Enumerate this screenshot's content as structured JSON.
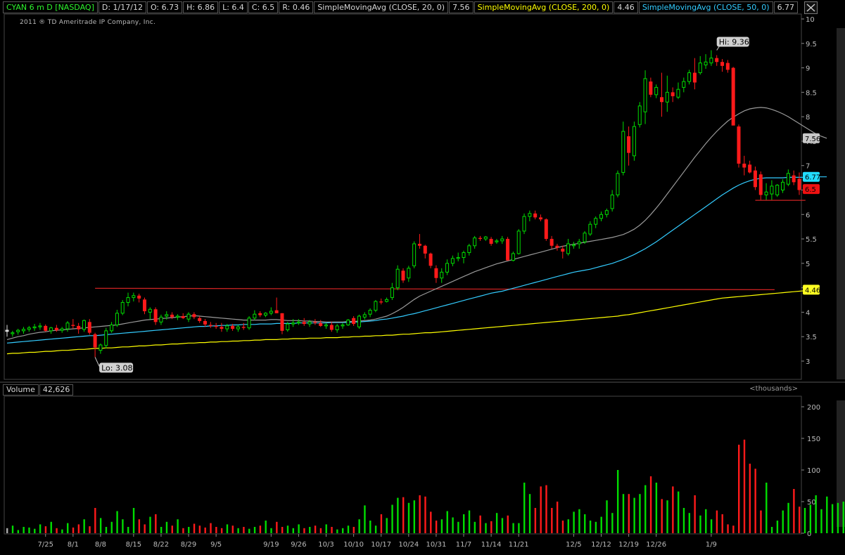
{
  "header": {
    "symbol": "CYAN 6 m D [NASDAQ]",
    "date": "D: 1/17/12",
    "open": "O: 6.73",
    "high": "H: 6.86",
    "low": "L: 6.4",
    "close": "C: 6.5",
    "range": "R: 0.46",
    "sma20_label": "SimpleMovingAvg (CLOSE, 20, 0)",
    "sma20_value": "7.56",
    "sma200_label": "SimpleMovingAvg (CLOSE, 200, 0)",
    "sma200_value": "4.46",
    "sma50_label": "SimpleMovingAvg (CLOSE, 50, 0)",
    "sma50_value": "6.77"
  },
  "copyright": "2011 ® TD Ameritrade IP Company, Inc.",
  "volume_header": {
    "label": "Volume",
    "value": "42,626",
    "units": "<thousands>"
  },
  "icons": {
    "close": "close-icon"
  },
  "colors": {
    "up": "#00dd00",
    "down": "#ff1a1a",
    "sma20": "#9a9a9a",
    "sma50": "#33ccff",
    "sma200": "#ffff00",
    "support": "#cc2222"
  },
  "chart_data": {
    "type": "candlestick",
    "price_axis": {
      "min": 2.5,
      "max": 10,
      "ticks": [
        3,
        3.5,
        4,
        4.5,
        5,
        5.5,
        6,
        6.5,
        7,
        7.5,
        8,
        8.5,
        9,
        9.5,
        10
      ],
      "tick_labels": [
        "3",
        "3.5",
        "4",
        "4.5",
        "5",
        "5.5",
        "6",
        "6.5",
        "7",
        "7.5",
        "8",
        "8.5",
        "9",
        "9.5",
        "10"
      ]
    },
    "volume_axis": {
      "min": 0,
      "max": 220,
      "ticks": [
        0,
        50,
        100,
        150,
        200
      ],
      "tick_labels": [
        "0",
        "50",
        "100",
        "150",
        "200"
      ]
    },
    "x_labels": [
      "7/25",
      "8/1",
      "8/8",
      "8/15",
      "8/22",
      "8/29",
      "9/5",
      "9/19",
      "9/26",
      "10/3",
      "10/10",
      "10/17",
      "10/24",
      "10/31",
      "11/7",
      "11/14",
      "11/21",
      "12/5",
      "12/12",
      "12/19",
      "12/26",
      "1/9"
    ],
    "annotations": {
      "high": "Hi: 9.36",
      "low": "Lo: 3.08"
    },
    "value_badges": {
      "sma20": "7.56",
      "sma50": "6.77",
      "last": "6.5",
      "sma200": "4.46"
    },
    "candles": [
      [
        3.64,
        3.74,
        3.5,
        3.6
      ],
      [
        3.56,
        3.62,
        3.5,
        3.58
      ],
      [
        3.6,
        3.66,
        3.54,
        3.63
      ],
      [
        3.62,
        3.7,
        3.56,
        3.65
      ],
      [
        3.65,
        3.72,
        3.6,
        3.68
      ],
      [
        3.68,
        3.76,
        3.62,
        3.7
      ],
      [
        3.7,
        3.78,
        3.64,
        3.72
      ],
      [
        3.72,
        3.75,
        3.6,
        3.62
      ],
      [
        3.62,
        3.7,
        3.56,
        3.68
      ],
      [
        3.68,
        3.74,
        3.6,
        3.63
      ],
      [
        3.63,
        3.7,
        3.58,
        3.66
      ],
      [
        3.66,
        3.82,
        3.6,
        3.78
      ],
      [
        3.74,
        3.86,
        3.66,
        3.72
      ],
      [
        3.72,
        3.78,
        3.56,
        3.65
      ],
      [
        3.65,
        3.85,
        3.6,
        3.83
      ],
      [
        3.8,
        3.86,
        3.54,
        3.58
      ],
      [
        3.55,
        3.58,
        3.08,
        3.28
      ],
      [
        3.22,
        3.36,
        3.15,
        3.33
      ],
      [
        3.32,
        3.68,
        3.26,
        3.62
      ],
      [
        3.62,
        3.8,
        3.58,
        3.74
      ],
      [
        3.74,
        4.05,
        3.7,
        3.98
      ],
      [
        3.98,
        4.25,
        3.94,
        4.2
      ],
      [
        4.2,
        4.4,
        4.12,
        4.3
      ],
      [
        4.3,
        4.4,
        4.22,
        4.34
      ],
      [
        4.34,
        4.38,
        4.2,
        4.28
      ],
      [
        4.26,
        4.3,
        3.96,
        4.02
      ],
      [
        4.0,
        4.1,
        3.85,
        4.06
      ],
      [
        4.06,
        4.1,
        3.74,
        3.8
      ],
      [
        3.8,
        3.95,
        3.74,
        3.9
      ],
      [
        3.92,
        4.02,
        3.85,
        3.95
      ],
      [
        3.95,
        4.0,
        3.86,
        3.9
      ],
      [
        3.9,
        3.96,
        3.84,
        3.92
      ],
      [
        3.92,
        3.98,
        3.86,
        3.88
      ],
      [
        3.86,
        4.0,
        3.8,
        3.96
      ],
      [
        3.96,
        4.0,
        3.86,
        3.9
      ],
      [
        3.88,
        3.92,
        3.78,
        3.82
      ],
      [
        3.82,
        3.86,
        3.7,
        3.75
      ],
      [
        3.74,
        3.8,
        3.68,
        3.72
      ],
      [
        3.72,
        3.78,
        3.66,
        3.7
      ],
      [
        3.7,
        3.78,
        3.6,
        3.66
      ],
      [
        3.66,
        3.76,
        3.6,
        3.72
      ],
      [
        3.72,
        3.76,
        3.62,
        3.66
      ],
      [
        3.66,
        3.74,
        3.6,
        3.7
      ],
      [
        3.7,
        3.78,
        3.64,
        3.68
      ],
      [
        3.68,
        3.92,
        3.64,
        3.88
      ],
      [
        3.88,
        4.04,
        3.84,
        3.96
      ],
      [
        3.98,
        4.02,
        3.9,
        3.94
      ],
      [
        3.94,
        4.0,
        3.9,
        3.98
      ],
      [
        3.98,
        4.1,
        3.94,
        4.02
      ],
      [
        4.04,
        4.3,
        3.98,
        3.98
      ],
      [
        3.98,
        3.98,
        3.55,
        3.62
      ],
      [
        3.64,
        3.8,
        3.6,
        3.76
      ],
      [
        3.76,
        3.86,
        3.7,
        3.78
      ],
      [
        3.78,
        3.86,
        3.74,
        3.8
      ],
      [
        3.8,
        3.88,
        3.72,
        3.76
      ],
      [
        3.76,
        3.84,
        3.7,
        3.8
      ],
      [
        3.8,
        3.86,
        3.74,
        3.78
      ],
      [
        3.78,
        3.84,
        3.7,
        3.72
      ],
      [
        3.72,
        3.78,
        3.66,
        3.74
      ],
      [
        3.74,
        3.8,
        3.6,
        3.64
      ],
      [
        3.64,
        3.76,
        3.58,
        3.72
      ],
      [
        3.72,
        3.78,
        3.66,
        3.74
      ],
      [
        3.74,
        3.86,
        3.72,
        3.84
      ],
      [
        3.88,
        3.92,
        3.72,
        3.76
      ],
      [
        3.7,
        3.95,
        3.66,
        3.92
      ],
      [
        3.9,
        4.0,
        3.85,
        3.95
      ],
      [
        3.96,
        4.08,
        3.9,
        4.04
      ],
      [
        4.04,
        4.25,
        4.0,
        4.22
      ],
      [
        4.22,
        4.28,
        4.16,
        4.2
      ],
      [
        4.22,
        4.3,
        4.2,
        4.26
      ],
      [
        4.3,
        4.6,
        4.25,
        4.5
      ],
      [
        4.5,
        4.96,
        4.45,
        4.88
      ],
      [
        4.85,
        4.9,
        4.6,
        4.65
      ],
      [
        4.7,
        4.95,
        4.62,
        4.9
      ],
      [
        4.95,
        5.45,
        4.9,
        5.4
      ],
      [
        5.4,
        5.6,
        5.3,
        5.36
      ],
      [
        5.36,
        5.38,
        5.1,
        5.2
      ],
      [
        5.2,
        5.22,
        4.9,
        4.95
      ],
      [
        4.9,
        4.96,
        4.6,
        4.7
      ],
      [
        4.7,
        4.9,
        4.6,
        4.82
      ],
      [
        4.82,
        5.08,
        4.76,
        5.0
      ],
      [
        5.0,
        5.16,
        4.94,
        5.1
      ],
      [
        5.1,
        5.22,
        5.04,
        5.12
      ],
      [
        5.12,
        5.26,
        5.0,
        5.22
      ],
      [
        5.22,
        5.4,
        5.16,
        5.36
      ],
      [
        5.36,
        5.56,
        5.3,
        5.52
      ],
      [
        5.52,
        5.56,
        5.46,
        5.5
      ],
      [
        5.5,
        5.56,
        5.46,
        5.54
      ],
      [
        5.5,
        5.54,
        5.36,
        5.4
      ],
      [
        5.44,
        5.5,
        5.4,
        5.46
      ],
      [
        5.46,
        5.56,
        5.4,
        5.5
      ],
      [
        5.5,
        5.54,
        5.06,
        5.06
      ],
      [
        5.06,
        5.24,
        5.04,
        5.2
      ],
      [
        5.2,
        5.7,
        5.18,
        5.66
      ],
      [
        5.66,
        6.02,
        5.6,
        5.96
      ],
      [
        5.96,
        6.08,
        5.86,
        6.02
      ],
      [
        6.02,
        6.08,
        5.9,
        5.94
      ],
      [
        5.94,
        6.0,
        5.86,
        5.9
      ],
      [
        5.9,
        5.92,
        5.46,
        5.5
      ],
      [
        5.5,
        5.56,
        5.3,
        5.36
      ],
      [
        5.36,
        5.4,
        5.26,
        5.32
      ],
      [
        5.3,
        5.36,
        5.1,
        5.24
      ],
      [
        5.2,
        5.5,
        5.16,
        5.4
      ],
      [
        5.36,
        5.44,
        5.3,
        5.38
      ],
      [
        5.4,
        5.5,
        5.3,
        5.44
      ],
      [
        5.44,
        5.66,
        5.4,
        5.62
      ],
      [
        5.6,
        5.86,
        5.56,
        5.8
      ],
      [
        5.8,
        5.96,
        5.72,
        5.92
      ],
      [
        5.92,
        6.06,
        5.86,
        6.0
      ],
      [
        6.0,
        6.12,
        5.94,
        6.08
      ],
      [
        6.12,
        6.5,
        6.06,
        6.4
      ],
      [
        6.4,
        6.9,
        6.35,
        6.84
      ],
      [
        6.86,
        7.9,
        6.8,
        7.7
      ],
      [
        7.6,
        7.8,
        7.0,
        7.26
      ],
      [
        7.2,
        7.9,
        7.1,
        7.8
      ],
      [
        7.84,
        8.3,
        7.78,
        8.22
      ],
      [
        8.1,
        8.95,
        7.85,
        8.78
      ],
      [
        8.72,
        8.8,
        8.4,
        8.45
      ],
      [
        8.45,
        8.66,
        8.38,
        8.6
      ],
      [
        8.4,
        8.9,
        8.0,
        8.3
      ],
      [
        8.3,
        8.84,
        8.1,
        8.5
      ],
      [
        8.5,
        8.6,
        8.3,
        8.42
      ],
      [
        8.4,
        8.7,
        8.36,
        8.56
      ],
      [
        8.6,
        8.8,
        8.5,
        8.72
      ],
      [
        8.72,
        8.96,
        8.66,
        8.9
      ],
      [
        8.9,
        9.2,
        8.56,
        8.7
      ],
      [
        8.9,
        9.24,
        8.86,
        9.1
      ],
      [
        9.06,
        9.28,
        8.98,
        9.12
      ],
      [
        9.1,
        9.36,
        9.04,
        9.2
      ],
      [
        9.2,
        9.26,
        9.04,
        9.12
      ],
      [
        9.12,
        9.18,
        8.92,
        9.04
      ],
      [
        9.1,
        9.16,
        8.9,
        8.96
      ],
      [
        9.0,
        9.02,
        7.84,
        7.82
      ],
      [
        7.8,
        7.84,
        6.96,
        7.04
      ],
      [
        7.04,
        7.2,
        6.8,
        6.96
      ],
      [
        7.02,
        7.1,
        6.84,
        6.86
      ],
      [
        6.9,
        6.98,
        6.5,
        6.56
      ],
      [
        6.82,
        6.88,
        6.3,
        6.4
      ],
      [
        6.4,
        6.64,
        6.3,
        6.46
      ],
      [
        6.42,
        6.7,
        6.3,
        6.58
      ],
      [
        6.4,
        6.62,
        6.36,
        6.6
      ],
      [
        6.5,
        6.72,
        6.44,
        6.66
      ],
      [
        6.62,
        6.92,
        6.58,
        6.84
      ],
      [
        6.8,
        6.9,
        6.6,
        6.66
      ],
      [
        6.73,
        6.86,
        6.4,
        6.5
      ]
    ],
    "volume": [
      8,
      12,
      5,
      10,
      9,
      7,
      14,
      11,
      18,
      8,
      6,
      16,
      9,
      14,
      22,
      11,
      40,
      24,
      10,
      18,
      35,
      22,
      10,
      40,
      22,
      14,
      26,
      30,
      10,
      18,
      12,
      22,
      8,
      10,
      15,
      12,
      9,
      16,
      10,
      8,
      14,
      12,
      8,
      10,
      7,
      10,
      12,
      20,
      8,
      18,
      10,
      12,
      8,
      14,
      8,
      10,
      12,
      8,
      14,
      10,
      6,
      8,
      12,
      10,
      22,
      44,
      20,
      12,
      30,
      24,
      45,
      56,
      57,
      48,
      52,
      60,
      58,
      34,
      20,
      22,
      35,
      25,
      18,
      30,
      36,
      18,
      28,
      16,
      19,
      32,
      24,
      28,
      16,
      16,
      80,
      62,
      40,
      74,
      76,
      40,
      50,
      20,
      22,
      34,
      38,
      30,
      20,
      18,
      26,
      52,
      32,
      100,
      62,
      62,
      56,
      62,
      76,
      90,
      80,
      54,
      52,
      74,
      66,
      40,
      32,
      60,
      28,
      38,
      22,
      36,
      30,
      14,
      12,
      140,
      148,
      110,
      102,
      36,
      80,
      10,
      20,
      36,
      48,
      70,
      42,
      40,
      45,
      60,
      38,
      58,
      46,
      48,
      50,
      24,
      50,
      60,
      36,
      42,
      56,
      62,
      82,
      48,
      64,
      70,
      40,
      56,
      34,
      138,
      146,
      150,
      104,
      56,
      74,
      12,
      24,
      34,
      48,
      58,
      34,
      50,
      40,
      48,
      28,
      36,
      50,
      60,
      44,
      56,
      80,
      46
    ],
    "sma20": [
      3.44,
      3.47,
      3.5,
      3.52,
      3.55,
      3.57,
      3.59,
      3.6,
      3.62,
      3.63,
      3.64,
      3.65,
      3.66,
      3.67,
      3.68,
      3.69,
      3.7,
      3.71,
      3.72,
      3.73,
      3.74,
      3.76,
      3.78,
      3.8,
      3.82,
      3.84,
      3.85,
      3.86,
      3.87,
      3.88,
      3.89,
      3.9,
      3.91,
      3.92,
      3.93,
      3.92,
      3.91,
      3.9,
      3.89,
      3.88,
      3.87,
      3.86,
      3.85,
      3.84,
      3.84,
      3.84,
      3.84,
      3.84,
      3.85,
      3.85,
      3.84,
      3.83,
      3.83,
      3.83,
      3.82,
      3.82,
      3.81,
      3.81,
      3.8,
      3.8,
      3.8,
      3.8,
      3.81,
      3.81,
      3.82,
      3.83,
      3.84,
      3.86,
      3.89,
      3.92,
      3.97,
      4.03,
      4.1,
      4.18,
      4.26,
      4.33,
      4.38,
      4.43,
      4.48,
      4.53,
      4.58,
      4.63,
      4.68,
      4.73,
      4.78,
      4.83,
      4.87,
      4.91,
      4.95,
      4.99,
      5.02,
      5.05,
      5.08,
      5.11,
      5.14,
      5.17,
      5.2,
      5.23,
      5.26,
      5.29,
      5.32,
      5.35,
      5.37,
      5.39,
      5.41,
      5.43,
      5.45,
      5.47,
      5.49,
      5.51,
      5.53,
      5.56,
      5.59,
      5.64,
      5.7,
      5.78,
      5.88,
      6.0,
      6.13,
      6.27,
      6.42,
      6.57,
      6.72,
      6.87,
      7.02,
      7.17,
      7.31,
      7.45,
      7.58,
      7.7,
      7.81,
      7.91,
      7.99,
      8.06,
      8.12,
      8.16,
      8.18,
      8.19,
      8.18,
      8.15,
      8.11,
      8.06,
      8.0,
      7.93,
      7.86,
      7.79,
      7.72,
      7.65,
      7.6,
      7.56
    ],
    "sma50": [
      3.37,
      3.38,
      3.39,
      3.4,
      3.41,
      3.42,
      3.43,
      3.44,
      3.45,
      3.46,
      3.47,
      3.48,
      3.49,
      3.5,
      3.51,
      3.52,
      3.52,
      3.53,
      3.54,
      3.55,
      3.56,
      3.57,
      3.58,
      3.59,
      3.6,
      3.61,
      3.62,
      3.63,
      3.64,
      3.65,
      3.66,
      3.67,
      3.68,
      3.69,
      3.7,
      3.71,
      3.71,
      3.72,
      3.72,
      3.73,
      3.73,
      3.74,
      3.74,
      3.75,
      3.75,
      3.75,
      3.76,
      3.76,
      3.76,
      3.77,
      3.77,
      3.77,
      3.77,
      3.78,
      3.78,
      3.78,
      3.78,
      3.78,
      3.78,
      3.79,
      3.79,
      3.79,
      3.79,
      3.8,
      3.8,
      3.81,
      3.82,
      3.83,
      3.85,
      3.86,
      3.88,
      3.9,
      3.92,
      3.95,
      3.97,
      4.0,
      4.03,
      4.06,
      4.09,
      4.12,
      4.15,
      4.18,
      4.21,
      4.24,
      4.27,
      4.3,
      4.33,
      4.36,
      4.39,
      4.41,
      4.43,
      4.46,
      4.49,
      4.52,
      4.55,
      4.58,
      4.61,
      4.64,
      4.67,
      4.7,
      4.73,
      4.76,
      4.79,
      4.82,
      4.84,
      4.86,
      4.88,
      4.91,
      4.94,
      4.97,
      5.0,
      5.04,
      5.08,
      5.13,
      5.18,
      5.24,
      5.3,
      5.37,
      5.44,
      5.52,
      5.6,
      5.68,
      5.76,
      5.84,
      5.92,
      6.0,
      6.08,
      6.16,
      6.24,
      6.32,
      6.4,
      6.47,
      6.54,
      6.6,
      6.65,
      6.69,
      6.72,
      6.74,
      6.75,
      6.75,
      6.75,
      6.75,
      6.76,
      6.76,
      6.76,
      6.76,
      6.76,
      6.77,
      6.77,
      6.77
    ],
    "sma200": [
      3.15,
      3.16,
      3.16,
      3.17,
      3.18,
      3.18,
      3.19,
      3.2,
      3.2,
      3.21,
      3.22,
      3.22,
      3.23,
      3.24,
      3.24,
      3.25,
      3.26,
      3.26,
      3.27,
      3.27,
      3.28,
      3.29,
      3.29,
      3.3,
      3.31,
      3.31,
      3.32,
      3.33,
      3.33,
      3.34,
      3.35,
      3.35,
      3.36,
      3.37,
      3.37,
      3.38,
      3.38,
      3.39,
      3.39,
      3.4,
      3.4,
      3.41,
      3.41,
      3.42,
      3.42,
      3.43,
      3.43,
      3.44,
      3.44,
      3.44,
      3.45,
      3.45,
      3.46,
      3.46,
      3.46,
      3.47,
      3.47,
      3.47,
      3.48,
      3.48,
      3.48,
      3.49,
      3.49,
      3.5,
      3.5,
      3.51,
      3.51,
      3.52,
      3.52,
      3.53,
      3.53,
      3.54,
      3.55,
      3.55,
      3.56,
      3.57,
      3.58,
      3.58,
      3.59,
      3.6,
      3.61,
      3.62,
      3.63,
      3.64,
      3.65,
      3.66,
      3.67,
      3.68,
      3.69,
      3.7,
      3.71,
      3.72,
      3.73,
      3.74,
      3.75,
      3.76,
      3.77,
      3.78,
      3.79,
      3.8,
      3.81,
      3.82,
      3.83,
      3.84,
      3.85,
      3.86,
      3.87,
      3.88,
      3.89,
      3.9,
      3.91,
      3.92,
      3.94,
      3.95,
      3.97,
      3.99,
      4.01,
      4.03,
      4.05,
      4.07,
      4.09,
      4.11,
      4.13,
      4.15,
      4.17,
      4.19,
      4.21,
      4.23,
      4.25,
      4.27,
      4.29,
      4.3,
      4.31,
      4.32,
      4.33,
      4.34,
      4.35,
      4.36,
      4.37,
      4.38,
      4.39,
      4.4,
      4.41,
      4.42,
      4.43,
      4.44,
      4.45,
      4.46
    ],
    "support_levels": [
      4.49,
      6.29
    ]
  }
}
